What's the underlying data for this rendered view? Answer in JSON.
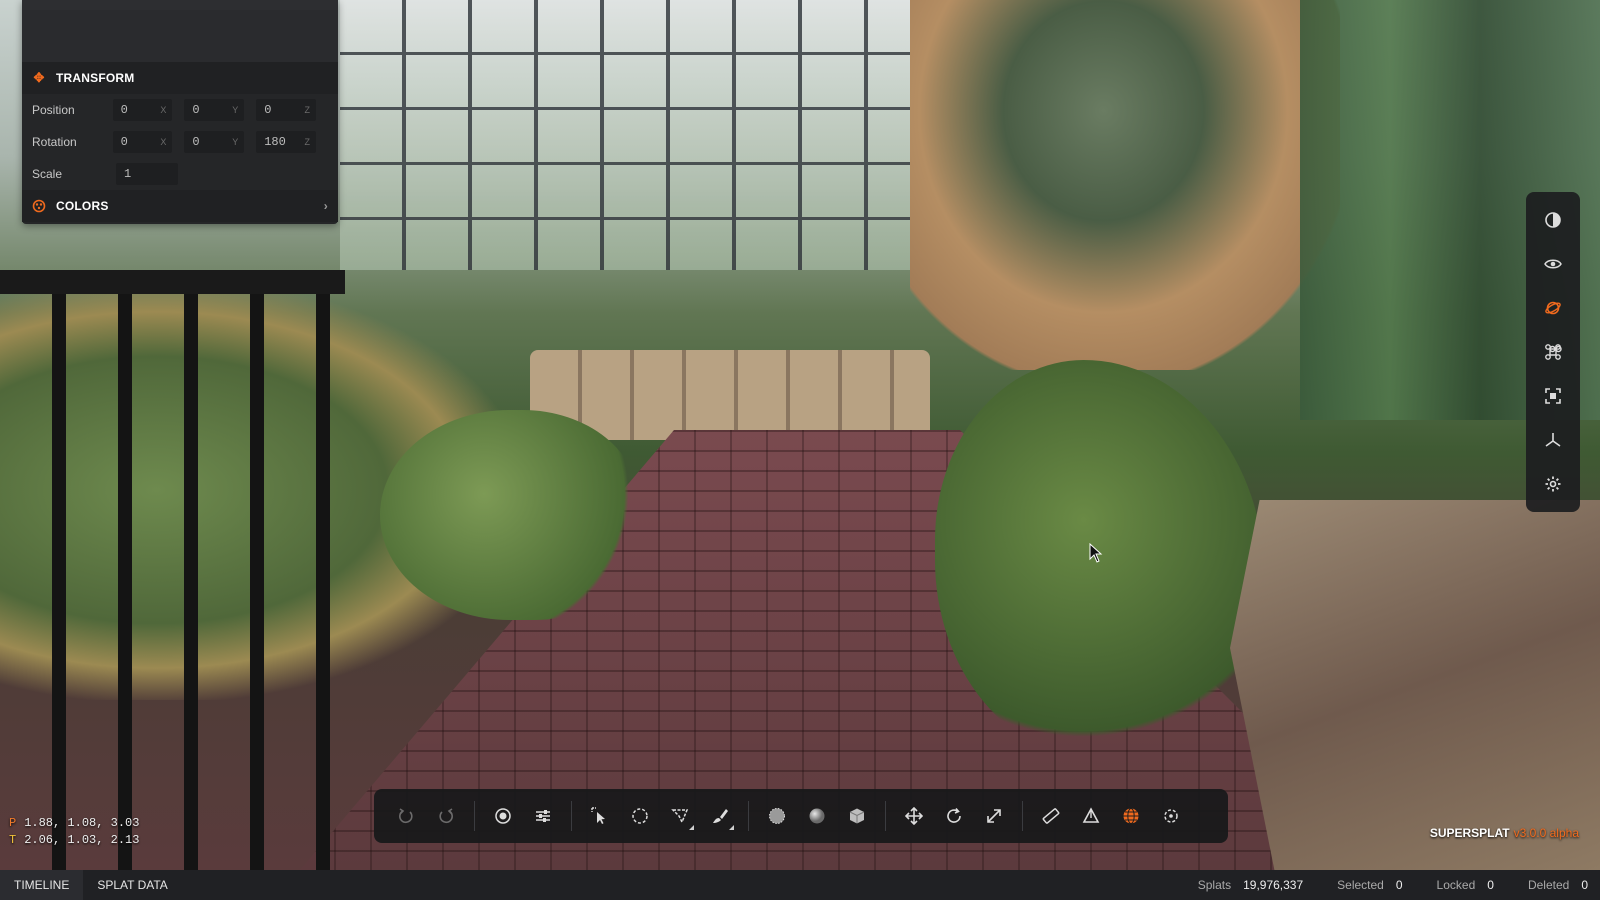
{
  "panel": {
    "transform": {
      "title": "TRANSFORM",
      "icon": "move-icon",
      "position": {
        "label": "Position",
        "x": "0",
        "y": "0",
        "z": "0"
      },
      "rotation": {
        "label": "Rotation",
        "x": "0",
        "y": "0",
        "z": "180"
      },
      "scale": {
        "label": "Scale",
        "value": "1"
      }
    },
    "colors": {
      "title": "COLORS",
      "icon": "palette-icon"
    },
    "axis_labels": {
      "x": "X",
      "y": "Y",
      "z": "Z"
    }
  },
  "right_toolbar": {
    "items": [
      {
        "name": "contrast-icon"
      },
      {
        "name": "eye-icon"
      },
      {
        "name": "orbit-icon",
        "active": true
      },
      {
        "name": "command-icon"
      },
      {
        "name": "frame-icon"
      },
      {
        "name": "axes-icon"
      },
      {
        "name": "gear-icon"
      }
    ]
  },
  "bottom_toolbar": {
    "groups": [
      [
        "undo-icon",
        "redo-icon"
      ],
      [
        "picker-icon",
        "sliders-icon"
      ],
      [
        "pointer-select-icon",
        "lasso-icon",
        "polygon-select-icon",
        "brush-icon"
      ],
      [
        "splat-view-icon",
        "sphere-icon",
        "box-icon"
      ],
      [
        "translate-icon",
        "rotate-icon",
        "scale-icon"
      ],
      [
        "measure-icon",
        "pivot-icon",
        "coord-space-icon",
        "origin-icon"
      ]
    ]
  },
  "camera": {
    "position_label": "P",
    "position": "1.88, 1.08, 3.03",
    "target_label": "T",
    "target": "2.06, 1.03, 2.13"
  },
  "brand": {
    "name": "SUPERSPLAT",
    "version": "v3.0.0 alpha"
  },
  "statusbar": {
    "tabs": [
      "TIMELINE",
      "SPLAT DATA"
    ],
    "stats": {
      "splats_label": "Splats",
      "splats": "19,976,337",
      "selected_label": "Selected",
      "selected": "0",
      "locked_label": "Locked",
      "locked": "0",
      "deleted_label": "Deleted",
      "deleted": "0"
    }
  },
  "colors": {
    "accent": "#f06a1e",
    "panel": "#252628",
    "toolbar": "#18191b"
  }
}
